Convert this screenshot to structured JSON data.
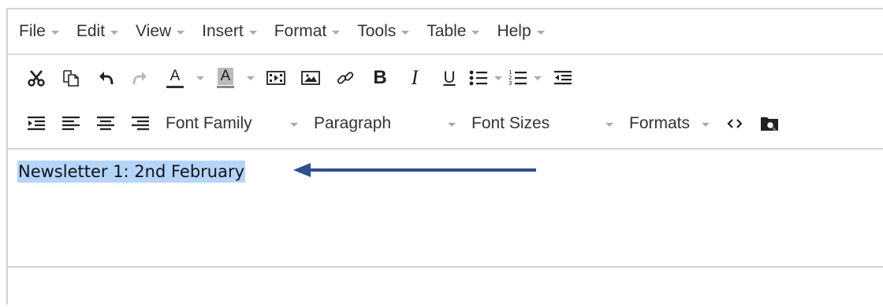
{
  "menubar": {
    "items": [
      {
        "label": "File"
      },
      {
        "label": "Edit"
      },
      {
        "label": "View"
      },
      {
        "label": "Insert"
      },
      {
        "label": "Format"
      },
      {
        "label": "Tools"
      },
      {
        "label": "Table"
      },
      {
        "label": "Help"
      }
    ]
  },
  "toolbar": {
    "row1_icons": [
      "cut-icon",
      "copy-icon",
      "undo-icon",
      "redo-icon",
      "text-color-icon",
      "background-color-icon",
      "media-icon",
      "image-icon",
      "link-icon",
      "bold-icon",
      "italic-icon",
      "underline-icon",
      "bullet-list-icon",
      "numbered-list-icon",
      "outdent-icon"
    ],
    "row2_icons": [
      "indent-icon",
      "align-left-icon",
      "align-center-icon",
      "align-right-icon",
      "code-icon",
      "preview-icon"
    ],
    "font_family": "Font Family",
    "paragraph": "Paragraph",
    "font_sizes": "Font Sizes",
    "formats": "Formats",
    "text_color_letter": "A",
    "bg_color_letter": "A",
    "bold_letter": "B",
    "italic_letter": "I",
    "underline_letter": "U"
  },
  "editor": {
    "content_text": "Newsletter 1: 2nd February",
    "selection_color": "#b5d5fc",
    "arrow_color": "#2f4f8f"
  }
}
